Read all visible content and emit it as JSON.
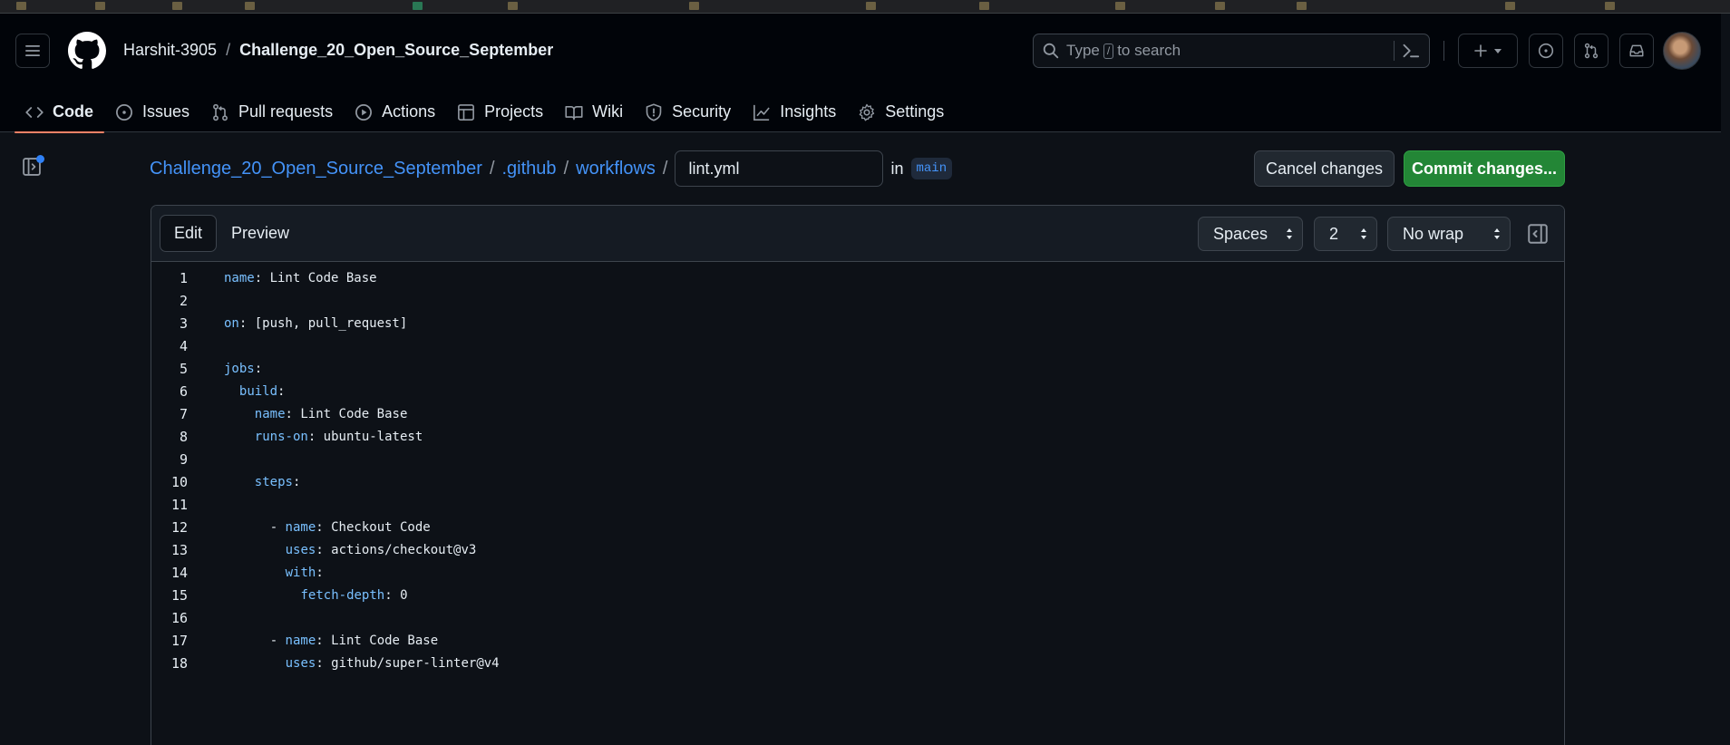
{
  "header": {
    "owner": "Harshit-3905",
    "repo": "Challenge_20_Open_Source_September",
    "search_placeholder": "to search",
    "search_prefix": "Type",
    "search_key": "/"
  },
  "tabs": [
    {
      "label": "Code",
      "icon": "code-icon",
      "selected": true
    },
    {
      "label": "Issues",
      "icon": "issue-opened-icon"
    },
    {
      "label": "Pull requests",
      "icon": "git-pull-request-icon"
    },
    {
      "label": "Actions",
      "icon": "play-icon"
    },
    {
      "label": "Projects",
      "icon": "table-icon"
    },
    {
      "label": "Wiki",
      "icon": "book-icon"
    },
    {
      "label": "Security",
      "icon": "shield-icon"
    },
    {
      "label": "Insights",
      "icon": "graph-icon"
    },
    {
      "label": "Settings",
      "icon": "gear-icon"
    }
  ],
  "breadcrumb": {
    "repo": "Challenge_20_Open_Source_September",
    "dir1": ".github",
    "dir2": "workflows",
    "filename": "lint.yml",
    "in_text": "in",
    "branch": "main"
  },
  "actions": {
    "cancel_label": "Cancel changes",
    "commit_label": "Commit changes..."
  },
  "editor": {
    "edit_label": "Edit",
    "preview_label": "Preview",
    "indent_mode": "Spaces",
    "indent_size": "2",
    "wrap_mode": "No wrap",
    "lines": [
      {
        "n": "1",
        "indent": 0,
        "key": "name",
        "rest": ": Lint Code Base"
      },
      {
        "n": "2",
        "indent": 0,
        "key": "",
        "rest": ""
      },
      {
        "n": "3",
        "indent": 0,
        "key": "on",
        "rest": ": [push, pull_request]"
      },
      {
        "n": "4",
        "indent": 0,
        "key": "",
        "rest": ""
      },
      {
        "n": "5",
        "indent": 0,
        "key": "jobs",
        "rest": ":"
      },
      {
        "n": "6",
        "indent": 2,
        "key": "build",
        "rest": ":"
      },
      {
        "n": "7",
        "indent": 4,
        "key": "name",
        "rest": ": Lint Code Base"
      },
      {
        "n": "8",
        "indent": 4,
        "key": "runs-on",
        "rest": ": ubuntu-latest"
      },
      {
        "n": "9",
        "indent": 0,
        "key": "",
        "rest": ""
      },
      {
        "n": "10",
        "indent": 4,
        "key": "steps",
        "rest": ":"
      },
      {
        "n": "11",
        "indent": 0,
        "key": "",
        "rest": ""
      },
      {
        "n": "12",
        "indent": 6,
        "dash": true,
        "key": "name",
        "rest": ": Checkout Code"
      },
      {
        "n": "13",
        "indent": 8,
        "key": "uses",
        "rest": ": actions/checkout@v3"
      },
      {
        "n": "14",
        "indent": 8,
        "key": "with",
        "rest": ":"
      },
      {
        "n": "15",
        "indent": 10,
        "key": "fetch-depth",
        "rest": ": 0"
      },
      {
        "n": "16",
        "indent": 0,
        "key": "",
        "rest": ""
      },
      {
        "n": "17",
        "indent": 6,
        "dash": true,
        "key": "name",
        "rest": ": Lint Code Base"
      },
      {
        "n": "18",
        "indent": 8,
        "key": "uses",
        "rest": ": github/super-linter@v4"
      }
    ]
  },
  "colors": {
    "accent_link": "#4493f8",
    "commit_green": "#238636",
    "tab_underline": "#f78166",
    "yaml_key": "#79c0ff"
  }
}
